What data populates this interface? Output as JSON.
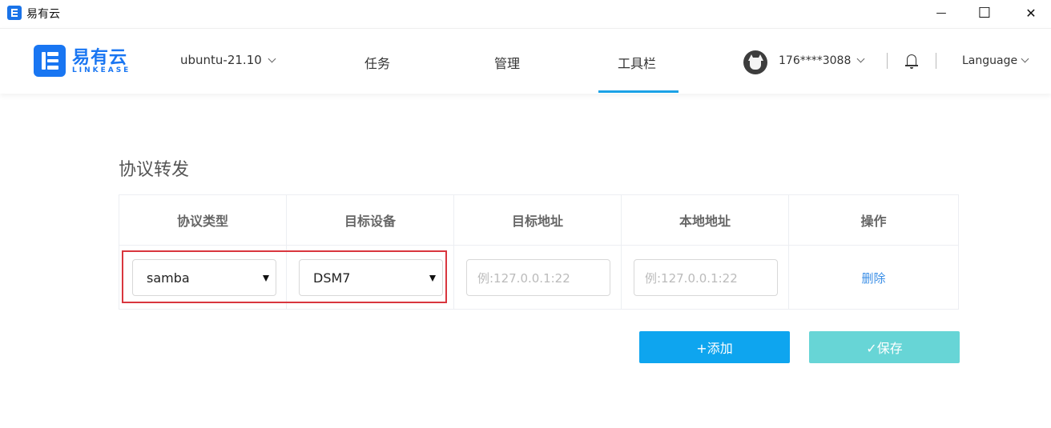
{
  "window": {
    "title": "易有云",
    "minimize_glyph": "—",
    "maximize_glyph": "☐",
    "close_glyph": "✕"
  },
  "header": {
    "brand_cn": "易有云",
    "brand_en": "LINKEASE",
    "device": "ubuntu-21.10",
    "tabs": [
      {
        "label": "任务"
      },
      {
        "label": "管理"
      },
      {
        "label": "工具栏",
        "active": true
      }
    ],
    "account": "176****3088",
    "language": "Language"
  },
  "page": {
    "title": "协议转发",
    "columns": [
      "协议类型",
      "目标设备",
      "目标地址",
      "本地地址",
      "操作"
    ],
    "row": {
      "protocol": "samba",
      "device": "DSM7",
      "target_placeholder": "例:127.0.0.1:22",
      "local_placeholder": "例:127.0.0.1:22",
      "delete_label": "删除"
    },
    "add_button": "+添加",
    "save_button": "✓保存"
  },
  "colors": {
    "brand": "#1976f2",
    "tab_underline": "#1aa1e6",
    "add_button": "#0ea5ef",
    "save_button": "#67d5d6",
    "highlight": "#d9363e",
    "link": "#3a8ee6"
  },
  "icons": [
    "app-logo-icon",
    "minimize-icon",
    "maximize-icon",
    "close-icon",
    "chevron-down-icon",
    "avatar-cat-icon",
    "bell-icon",
    "dropdown-arrow-icon"
  ]
}
